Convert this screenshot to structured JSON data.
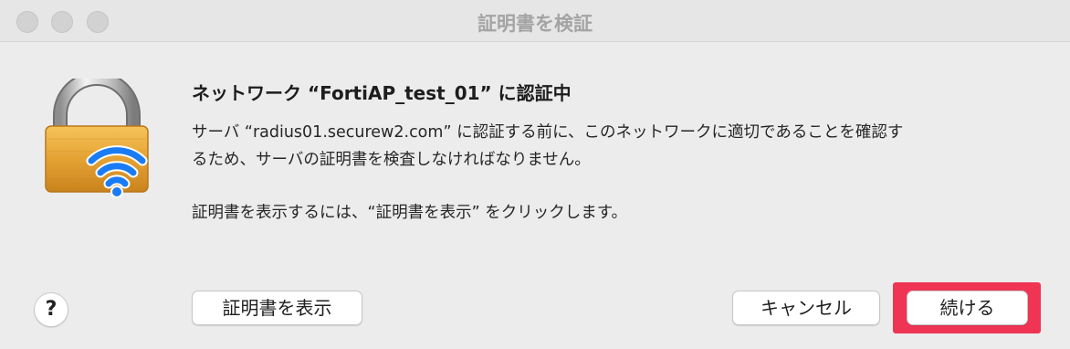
{
  "window": {
    "title": "証明書を検証"
  },
  "dialog": {
    "icon": "lock-wifi-icon",
    "heading": "ネットワーク “FortiAP_test_01” に認証中",
    "message_line1": "サーバ “radius01.securew2.com” に認証する前に、このネットワークに適切であることを確認す",
    "message_line2": "るため、サーバの証明書を検査しなければなりません。",
    "message_2": "証明書を表示するには、“証明書を表示” をクリックします。"
  },
  "buttons": {
    "help_label": "?",
    "show_certificate_label": "証明書を表示",
    "cancel_label": "キャンセル",
    "continue_label": "続ける"
  },
  "colors": {
    "highlight": "#f03554",
    "wifi": "#1a7cf5",
    "lock_body": "#e8a93a"
  }
}
